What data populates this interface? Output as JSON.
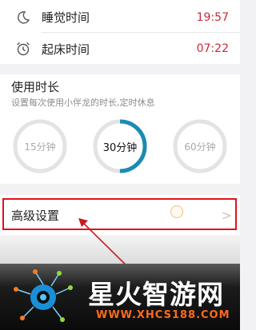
{
  "alarm_rows": [
    {
      "icon": "moon-icon",
      "label": "睡觉时间",
      "value": "19:57"
    },
    {
      "icon": "alarm-clock-icon",
      "label": "起床时间",
      "value": "07:22"
    }
  ],
  "usage": {
    "title": "使用时长",
    "subtitle": "设置每次使用小伴龙的时长,定时休息"
  },
  "timers": [
    {
      "label": "15分钟",
      "selected": false
    },
    {
      "label": "30分钟",
      "selected": true,
      "progress_fraction": 0.5
    },
    {
      "label": "60分钟",
      "selected": false
    }
  ],
  "advanced": {
    "label": "高级设置",
    "chevron": ">"
  },
  "colors": {
    "accent_time": "#d0263a",
    "ring_active": "#1b8bb3",
    "ring_idle": "#e3e3e3",
    "highlight": "#e0121b"
  },
  "watermark": {
    "title": "星火智游网",
    "url": "WWW.XHCS188.COM"
  }
}
